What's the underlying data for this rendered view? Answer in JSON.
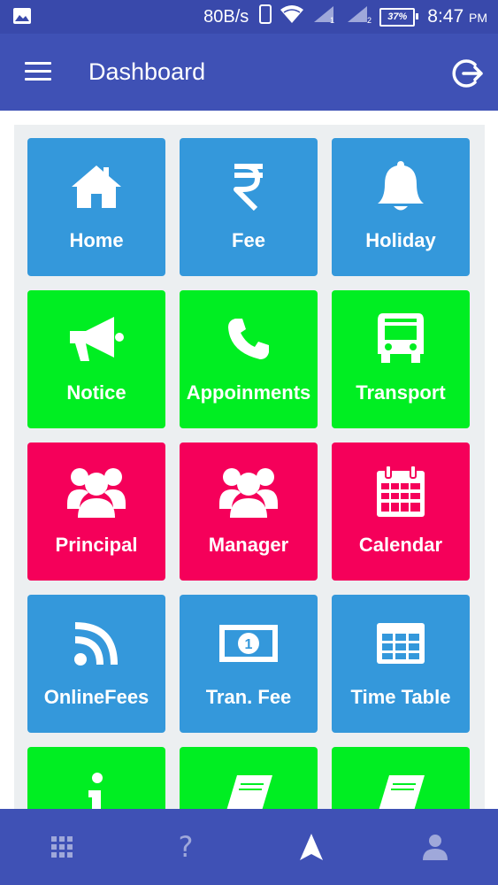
{
  "status_bar": {
    "speed": "80B/s",
    "battery": "37%",
    "time": "8:47",
    "ampm": "PM"
  },
  "app_bar": {
    "title": "Dashboard"
  },
  "tiles": [
    {
      "label": "Home",
      "icon": "home-icon",
      "color": "#3498db"
    },
    {
      "label": "Fee",
      "icon": "rupee-icon",
      "color": "#3498db"
    },
    {
      "label": "Holiday",
      "icon": "bell-icon",
      "color": "#3498db"
    },
    {
      "label": "Notice",
      "icon": "megaphone-icon",
      "color": "#00ee22"
    },
    {
      "label": "Appoinments",
      "icon": "phone-icon",
      "color": "#00ee22"
    },
    {
      "label": "Transport",
      "icon": "bus-icon",
      "color": "#00ee22"
    },
    {
      "label": "Principal",
      "icon": "users-icon",
      "color": "#f5005a"
    },
    {
      "label": "Manager",
      "icon": "users-icon",
      "color": "#f5005a"
    },
    {
      "label": "Calendar",
      "icon": "calendar-icon",
      "color": "#f5005a"
    },
    {
      "label": "OnlineFees",
      "icon": "rss-icon",
      "color": "#3498db"
    },
    {
      "label": "Tran. Fee",
      "icon": "money-icon",
      "color": "#3498db"
    },
    {
      "label": "Time Table",
      "icon": "table-icon",
      "color": "#3498db"
    },
    {
      "label": "",
      "icon": "info-icon",
      "color": "#00ee22"
    },
    {
      "label": "",
      "icon": "book-icon",
      "color": "#00ee22"
    },
    {
      "label": "",
      "icon": "book-icon",
      "color": "#00ee22"
    }
  ],
  "bottom_nav": [
    {
      "icon": "grid-icon",
      "text": ""
    },
    {
      "icon": "help-icon",
      "text": "?"
    },
    {
      "icon": "navigation-icon",
      "text": ""
    },
    {
      "icon": "person-icon",
      "text": ""
    }
  ],
  "colors": {
    "status_bar": "#3949ab",
    "app_bar": "#3f51b5",
    "blue": "#3498db",
    "green": "#00ee22",
    "pink": "#f5005a"
  }
}
